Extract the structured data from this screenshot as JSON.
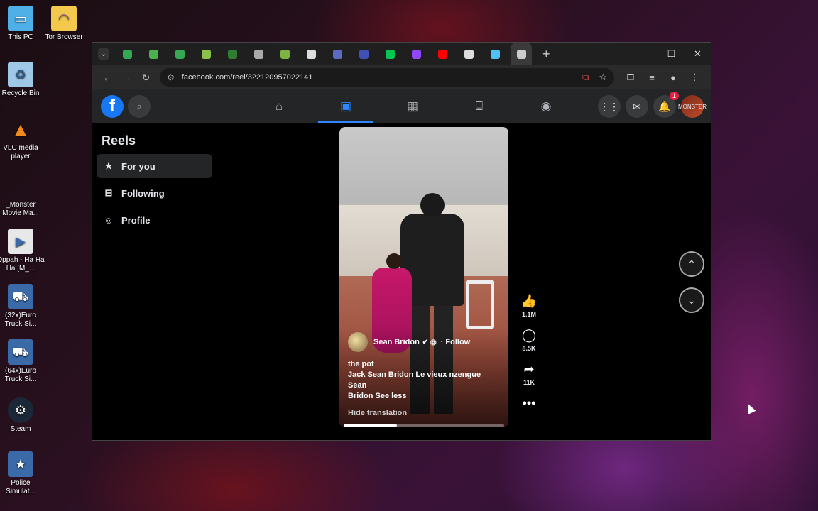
{
  "desktop": {
    "icons": [
      {
        "label": "This PC",
        "icon": "monitor-icon",
        "color": "#4fb0e8"
      },
      {
        "label": "Tor Browser",
        "icon": "folder-icon",
        "color": "#f2c94c"
      },
      {
        "label": "Recycle Bin",
        "icon": "recycle-bin-icon",
        "color": "#9fc7e8"
      },
      {
        "label": "VLC media player",
        "icon": "vlc-icon",
        "color": "#f08a1c"
      },
      {
        "label": "_Monster Movie Ma...",
        "icon": "file-icon",
        "color": "#222222"
      },
      {
        "label": "Oppah - Ha Ha Ha [M_...",
        "icon": "video-file-icon",
        "color": "#3a6aa8"
      },
      {
        "label": "(32x)Euro Truck Si...",
        "icon": "truck-icon",
        "color": "#3a6aa8"
      },
      {
        "label": "(64x)Euro Truck Si...",
        "icon": "truck-icon",
        "color": "#3a6aa8"
      },
      {
        "label": "Steam",
        "icon": "steam-icon",
        "color": "#1b2838"
      },
      {
        "label": "Police Simulat...",
        "icon": "police-icon",
        "color": "#3a6aa8"
      }
    ]
  },
  "browser": {
    "tab_favicon_colors": [
      "#34a853",
      "#4caf50",
      "#34a853",
      "#8bc34a",
      "#2e7d32",
      "#aaaaaa",
      "#7cb342",
      "#dddddd",
      "#5c6bc0",
      "#3f51b5",
      "#00c853",
      "#9146ff",
      "#ff0000",
      "#dddddd",
      "#4fc3f7",
      "#cccccc"
    ],
    "new_tab": "+",
    "url": "facebook.com/reel/322120957022141"
  },
  "facebook": {
    "logo": "f",
    "notification_count": "1",
    "avatar_text": "MONSTER"
  },
  "sidebar": {
    "title": "Reels",
    "items": [
      {
        "label": "For you",
        "icon": "star-icon"
      },
      {
        "label": "Following",
        "icon": "following-icon"
      },
      {
        "label": "Profile",
        "icon": "profile-icon"
      }
    ]
  },
  "reel": {
    "author": "Sean Bridon",
    "follow": "· Follow",
    "caption_1": "the pot",
    "caption_2": "Jack Sean Bridon Le vieux nzengue Sean",
    "caption_3": "Bridon See less",
    "hide_translation": "Hide translation",
    "progress": 0.33,
    "likes": "1.1M",
    "comments": "8.5K",
    "shares": "11K"
  }
}
